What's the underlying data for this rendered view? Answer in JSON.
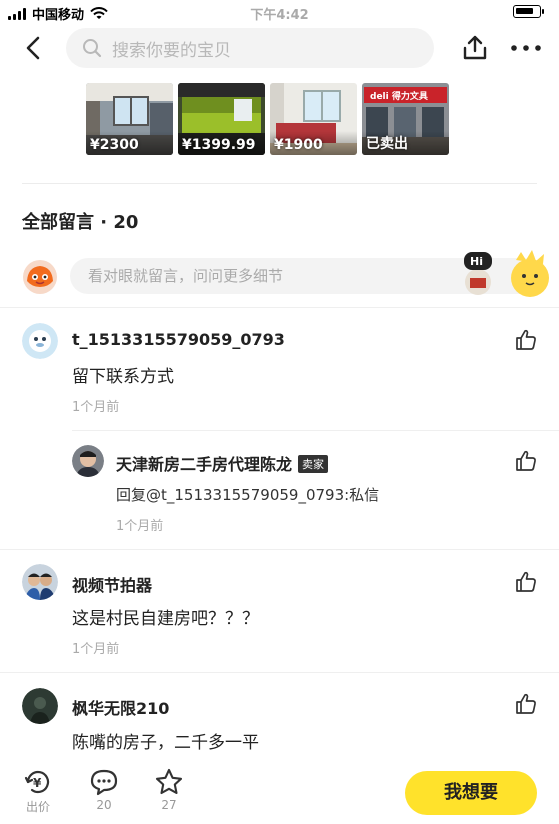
{
  "status_bar": {
    "carrier": "中国移动",
    "time": "下午4:42"
  },
  "search": {
    "placeholder": "搜索你要的宝贝"
  },
  "thumbnails": [
    {
      "price": "¥2300"
    },
    {
      "price": "¥1399.99"
    },
    {
      "price": "¥1900"
    },
    {
      "price": "已卖出",
      "sign_text": "deli 得力文具"
    }
  ],
  "comments_header": {
    "title": "全部留言 · 20"
  },
  "compose": {
    "placeholder": "看对眼就留言，问问更多细节",
    "mascot_text": "Hi"
  },
  "comments": [
    {
      "name": "t_1513315579059_0793",
      "text": "留下联系方式",
      "time": "1个月前"
    },
    {
      "name": "天津新房二手房代理陈龙",
      "badge": "卖家",
      "text": "回复@t_1513315579059_0793:私信",
      "time": "1个月前"
    },
    {
      "name": "视频节拍器",
      "text": "这是村民自建房吧？？？",
      "time": "1个月前"
    },
    {
      "name": "枫华无限210",
      "text": "陈嘴的房子，二千多一平"
    }
  ],
  "bottom_bar": {
    "bid": {
      "label": "出价",
      "icon_text": "¥"
    },
    "comments": {
      "label": "20"
    },
    "favorites": {
      "label": "27"
    },
    "want_button": "我想要"
  }
}
